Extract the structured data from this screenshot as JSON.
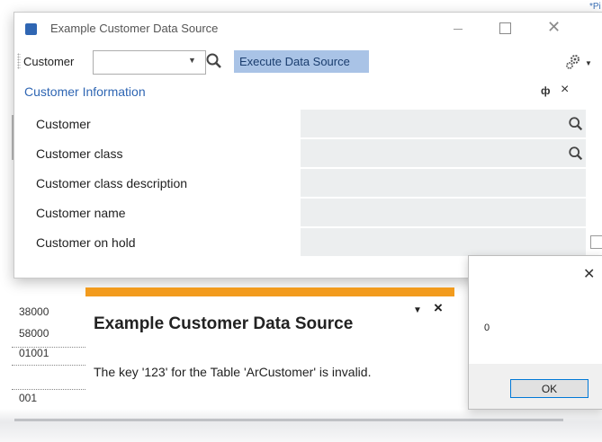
{
  "background": {
    "right_tabs_text": "*Pi",
    "list": [
      "38000",
      "58000",
      "01001",
      "001"
    ]
  },
  "window": {
    "title": "Example Customer Data Source",
    "toolbar": {
      "label": "Customer",
      "combo_value": "",
      "execute_label": "Execute Data Source"
    },
    "panel": {
      "title": "Customer Information",
      "fields": [
        {
          "label": "Customer",
          "value": "",
          "lookup": true
        },
        {
          "label": "Customer class",
          "value": "",
          "lookup": true
        },
        {
          "label": "Customer class description",
          "value": "",
          "lookup": false
        },
        {
          "label": "Customer name",
          "value": "",
          "lookup": false
        },
        {
          "label": "Customer on hold",
          "checkbox": true,
          "checked": false
        }
      ]
    }
  },
  "error": {
    "title": "Example Customer Data Source",
    "message": "The key '123' for the Table 'ArCustomer' is invalid."
  },
  "msgbox": {
    "text": "0",
    "ok_label": "OK"
  },
  "colors": {
    "accent": "#2f66b3",
    "execute_button": "#a9c3e6",
    "error_stripe": "#f29b1d",
    "field_bg": "#eceeef"
  }
}
